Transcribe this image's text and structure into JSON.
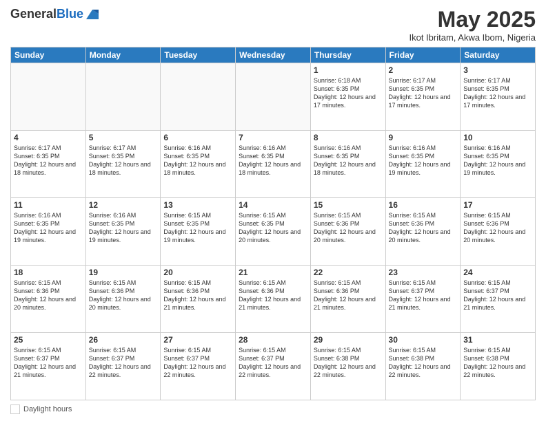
{
  "header": {
    "logo_line1": "General",
    "logo_line2": "Blue",
    "month": "May 2025",
    "location": "Ikot Ibritam, Akwa Ibom, Nigeria"
  },
  "days_of_week": [
    "Sunday",
    "Monday",
    "Tuesday",
    "Wednesday",
    "Thursday",
    "Friday",
    "Saturday"
  ],
  "weeks": [
    [
      {
        "day": "",
        "info": ""
      },
      {
        "day": "",
        "info": ""
      },
      {
        "day": "",
        "info": ""
      },
      {
        "day": "",
        "info": ""
      },
      {
        "day": "1",
        "info": "Sunrise: 6:18 AM\nSunset: 6:35 PM\nDaylight: 12 hours\nand 17 minutes."
      },
      {
        "day": "2",
        "info": "Sunrise: 6:17 AM\nSunset: 6:35 PM\nDaylight: 12 hours\nand 17 minutes."
      },
      {
        "day": "3",
        "info": "Sunrise: 6:17 AM\nSunset: 6:35 PM\nDaylight: 12 hours\nand 17 minutes."
      }
    ],
    [
      {
        "day": "4",
        "info": "Sunrise: 6:17 AM\nSunset: 6:35 PM\nDaylight: 12 hours\nand 18 minutes."
      },
      {
        "day": "5",
        "info": "Sunrise: 6:17 AM\nSunset: 6:35 PM\nDaylight: 12 hours\nand 18 minutes."
      },
      {
        "day": "6",
        "info": "Sunrise: 6:16 AM\nSunset: 6:35 PM\nDaylight: 12 hours\nand 18 minutes."
      },
      {
        "day": "7",
        "info": "Sunrise: 6:16 AM\nSunset: 6:35 PM\nDaylight: 12 hours\nand 18 minutes."
      },
      {
        "day": "8",
        "info": "Sunrise: 6:16 AM\nSunset: 6:35 PM\nDaylight: 12 hours\nand 18 minutes."
      },
      {
        "day": "9",
        "info": "Sunrise: 6:16 AM\nSunset: 6:35 PM\nDaylight: 12 hours\nand 19 minutes."
      },
      {
        "day": "10",
        "info": "Sunrise: 6:16 AM\nSunset: 6:35 PM\nDaylight: 12 hours\nand 19 minutes."
      }
    ],
    [
      {
        "day": "11",
        "info": "Sunrise: 6:16 AM\nSunset: 6:35 PM\nDaylight: 12 hours\nand 19 minutes."
      },
      {
        "day": "12",
        "info": "Sunrise: 6:16 AM\nSunset: 6:35 PM\nDaylight: 12 hours\nand 19 minutes."
      },
      {
        "day": "13",
        "info": "Sunrise: 6:15 AM\nSunset: 6:35 PM\nDaylight: 12 hours\nand 19 minutes."
      },
      {
        "day": "14",
        "info": "Sunrise: 6:15 AM\nSunset: 6:35 PM\nDaylight: 12 hours\nand 20 minutes."
      },
      {
        "day": "15",
        "info": "Sunrise: 6:15 AM\nSunset: 6:36 PM\nDaylight: 12 hours\nand 20 minutes."
      },
      {
        "day": "16",
        "info": "Sunrise: 6:15 AM\nSunset: 6:36 PM\nDaylight: 12 hours\nand 20 minutes."
      },
      {
        "day": "17",
        "info": "Sunrise: 6:15 AM\nSunset: 6:36 PM\nDaylight: 12 hours\nand 20 minutes."
      }
    ],
    [
      {
        "day": "18",
        "info": "Sunrise: 6:15 AM\nSunset: 6:36 PM\nDaylight: 12 hours\nand 20 minutes."
      },
      {
        "day": "19",
        "info": "Sunrise: 6:15 AM\nSunset: 6:36 PM\nDaylight: 12 hours\nand 20 minutes."
      },
      {
        "day": "20",
        "info": "Sunrise: 6:15 AM\nSunset: 6:36 PM\nDaylight: 12 hours\nand 21 minutes."
      },
      {
        "day": "21",
        "info": "Sunrise: 6:15 AM\nSunset: 6:36 PM\nDaylight: 12 hours\nand 21 minutes."
      },
      {
        "day": "22",
        "info": "Sunrise: 6:15 AM\nSunset: 6:36 PM\nDaylight: 12 hours\nand 21 minutes."
      },
      {
        "day": "23",
        "info": "Sunrise: 6:15 AM\nSunset: 6:37 PM\nDaylight: 12 hours\nand 21 minutes."
      },
      {
        "day": "24",
        "info": "Sunrise: 6:15 AM\nSunset: 6:37 PM\nDaylight: 12 hours\nand 21 minutes."
      }
    ],
    [
      {
        "day": "25",
        "info": "Sunrise: 6:15 AM\nSunset: 6:37 PM\nDaylight: 12 hours\nand 21 minutes."
      },
      {
        "day": "26",
        "info": "Sunrise: 6:15 AM\nSunset: 6:37 PM\nDaylight: 12 hours\nand 22 minutes."
      },
      {
        "day": "27",
        "info": "Sunrise: 6:15 AM\nSunset: 6:37 PM\nDaylight: 12 hours\nand 22 minutes."
      },
      {
        "day": "28",
        "info": "Sunrise: 6:15 AM\nSunset: 6:37 PM\nDaylight: 12 hours\nand 22 minutes."
      },
      {
        "day": "29",
        "info": "Sunrise: 6:15 AM\nSunset: 6:38 PM\nDaylight: 12 hours\nand 22 minutes."
      },
      {
        "day": "30",
        "info": "Sunrise: 6:15 AM\nSunset: 6:38 PM\nDaylight: 12 hours\nand 22 minutes."
      },
      {
        "day": "31",
        "info": "Sunrise: 6:15 AM\nSunset: 6:38 PM\nDaylight: 12 hours\nand 22 minutes."
      }
    ]
  ],
  "footer": {
    "label": "Daylight hours"
  }
}
